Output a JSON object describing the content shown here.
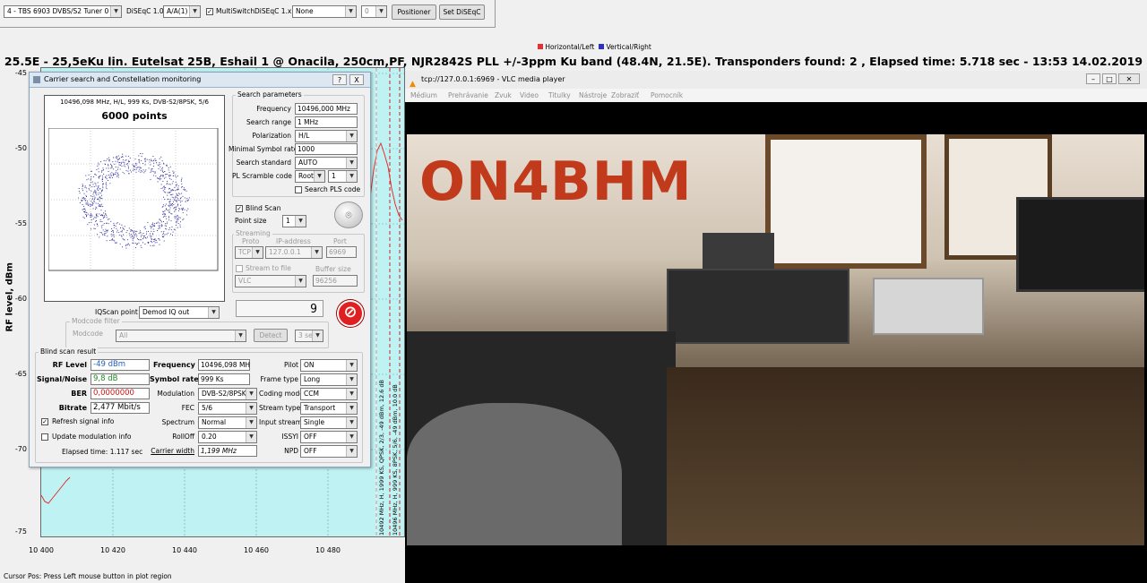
{
  "toolbar": {
    "tuner_select": "4 - TBS 6903 DVBS/S2 Tuner 0",
    "diseqc10_label": "DiSEqC 1.0:",
    "diseqc10_value": "A/A(1)",
    "multiswitch_label": "MultiSwitch",
    "diseqc1x_label": "DiSEqC 1.x:",
    "diseqc1x_value": "None",
    "diseqc1x_num": "0",
    "positioner_button": "Positioner",
    "set_diseqc_button": "Set DiSEqC"
  },
  "legend": {
    "horizontal": "Horizontal/Left",
    "vertical": "Vertical/Right",
    "horizontal_color": "#e53030",
    "vertical_color": "#3030c0"
  },
  "plot": {
    "title": "25.5E - 25,5eKu lin. Eutelsat 25B, Eshail 1 @ Onacila, 250cm,PF, NJR2842S PLL +/-3ppm Ku band (48.4N, 21.5E). Transponders found: 2 , Elapsed time: 5.718 sec - 13:53 14.02.2019",
    "ylabel": "RF level, dBm",
    "yticks": [
      "-45",
      "-50",
      "-55",
      "-60",
      "-65",
      "-70",
      "-75"
    ],
    "xticks": [
      "10 400",
      "10 420",
      "10 440",
      "10 460",
      "10 480"
    ],
    "tp_label_1": "10492 MHz, H, 1999 KS, QPSK, 2/3, -49 dBm, 12.6 dB",
    "tp_label_2": "10496 MHz, H, 999 KS, 8PSK, 5/6, -49 dBm, 10.0 dB",
    "cursor_pos": "Cursor Pos: Press Left mouse button in plot region"
  },
  "dialog": {
    "title": "Carrier search and Constellation monitoring",
    "help_button": "?",
    "close_button": "X",
    "const_info": "10496,098 MHz, H/L, 999 Ks, DVB-S2/8PSK, 5/6",
    "const_points": "6000 points",
    "search_params_title": "Search parameters",
    "frequency_label": "Frequency",
    "frequency_value": "10496,000 MHz",
    "range_label": "Search range",
    "range_value": "1 MHz",
    "pol_label": "Polarization",
    "pol_value": "H/L",
    "minsr_label": "Minimal Symbol rate",
    "minsr_value": "1000",
    "std_label": "Search standard",
    "std_value": "AUTO",
    "pls_label": "PL Scramble code",
    "pls_mode": "Root",
    "pls_value": "1",
    "search_pls_label": "Search PLS code",
    "blind_scan_label": "Blind Scan",
    "point_size_label": "Point size",
    "point_size_value": "1",
    "streaming_title": "Streaming",
    "proto_label": "Proto",
    "proto_value": "TCP",
    "ip_label": "IP-address",
    "ip_value": "127.0.0.1",
    "port_label": "Port",
    "port_value": "6969",
    "stream_file_label": "Stream to file",
    "buffer_label": "Buffer size",
    "player_value": "VLC",
    "buffer_value": "96256",
    "iq_label": "IQScan point",
    "iq_value": "Demod IQ out",
    "counter_value": "9",
    "modcode_title": "Modcode filter",
    "modcode_label": "Modcode",
    "modcode_value": "All",
    "detect_button": "Detect",
    "detect_time": "3 sec",
    "result_title": "Blind scan result",
    "rf_label": "RF Level",
    "rf_value": "-49 dBm",
    "sn_label": "Signal/Noise",
    "sn_value": "9,8 dB",
    "ber_label": "BER",
    "ber_value": "0,0000000",
    "bitrate_label": "Bitrate",
    "bitrate_value": "2,477 Mbit/s",
    "freq_label": "Frequency",
    "freq_value": "10496,098 MH",
    "sr_label": "Symbol rate",
    "sr_value": "999 Ks",
    "mod_label": "Modulation",
    "mod_value": "DVB-S2/8PSK",
    "fec_label": "FEC",
    "fec_value": "5/6",
    "spectrum_label": "Spectrum",
    "spectrum_value": "Normal",
    "rolloff_label": "RollOff",
    "rolloff_value": "0.20",
    "cw_label": "Carrier width",
    "cw_value": "1,199 MHz",
    "pilot_label": "Pilot",
    "pilot_value": "ON",
    "frame_label": "Frame type",
    "frame_value": "Long",
    "coding_label": "Coding mode",
    "coding_value": "CCM",
    "stype_label": "Stream type",
    "stype_value": "Transport",
    "input_label": "Input stream",
    "input_value": "Single",
    "issyi_label": "ISSYI",
    "issyi_value": "OFF",
    "npd_label": "NPD",
    "npd_value": "OFF",
    "refresh_label": "Refresh signal info",
    "update_mod_label": "Update modulation info",
    "elapsed": "Elapsed time: 1.117 sec"
  },
  "vlc": {
    "title": "tcp://127.0.0.1:6969 - VLC media player",
    "menu": [
      "Médium",
      "Prehrávanie",
      "Zvuk",
      "Video",
      "Titulky",
      "Nástroje",
      "Zobraziť",
      "Pomocník"
    ],
    "overlay_text": "ON4BHM",
    "overlay_color": "#c23a1c"
  }
}
